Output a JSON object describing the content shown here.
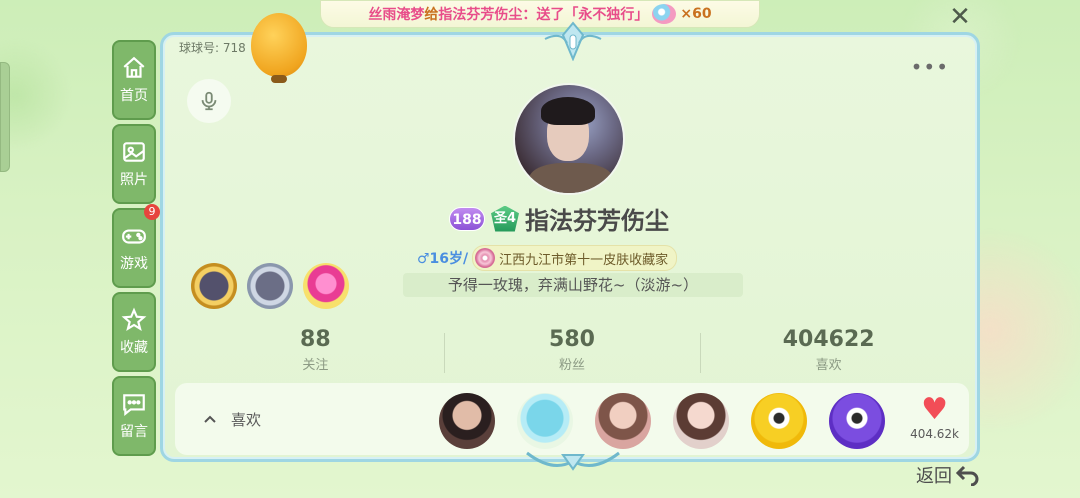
{
  "banner": {
    "sender": "丝雨淹梦",
    "verb": "给",
    "receiver": "指法芬芳伤尘",
    "action": "：送了「永不独行」",
    "count": "×60"
  },
  "sidebar": {
    "items": [
      {
        "label": "首页",
        "icon": "home-icon"
      },
      {
        "label": "照片",
        "icon": "image-icon"
      },
      {
        "label": "游戏",
        "icon": "gamepad-icon",
        "badge": "9"
      },
      {
        "label": "收藏",
        "icon": "star-icon"
      },
      {
        "label": "留言",
        "icon": "message-icon"
      }
    ]
  },
  "profile": {
    "qq_id_label": "球球号: 718",
    "level": "188",
    "saint_badge": "圣4",
    "nickname": "指法芬芳伤尘",
    "gender_age": "♂16岁/",
    "title": "江西九江市第十一皮肤收藏家",
    "motto": "予得一玫瑰，弃满山野花~（淡游~）"
  },
  "stats": [
    {
      "value": "88",
      "label": "关注"
    },
    {
      "value": "580",
      "label": "粉丝"
    },
    {
      "value": "404622",
      "label": "喜欢"
    }
  ],
  "likes_bar": {
    "toggle_label": "喜欢",
    "total": "404.62k"
  },
  "nav": {
    "back_label": "返回"
  },
  "colors": {
    "sidebar_bg": "#7fb86a",
    "card_border": "#9fd6e3",
    "badge_red": "#e7453d",
    "heart": "#f24d57"
  }
}
